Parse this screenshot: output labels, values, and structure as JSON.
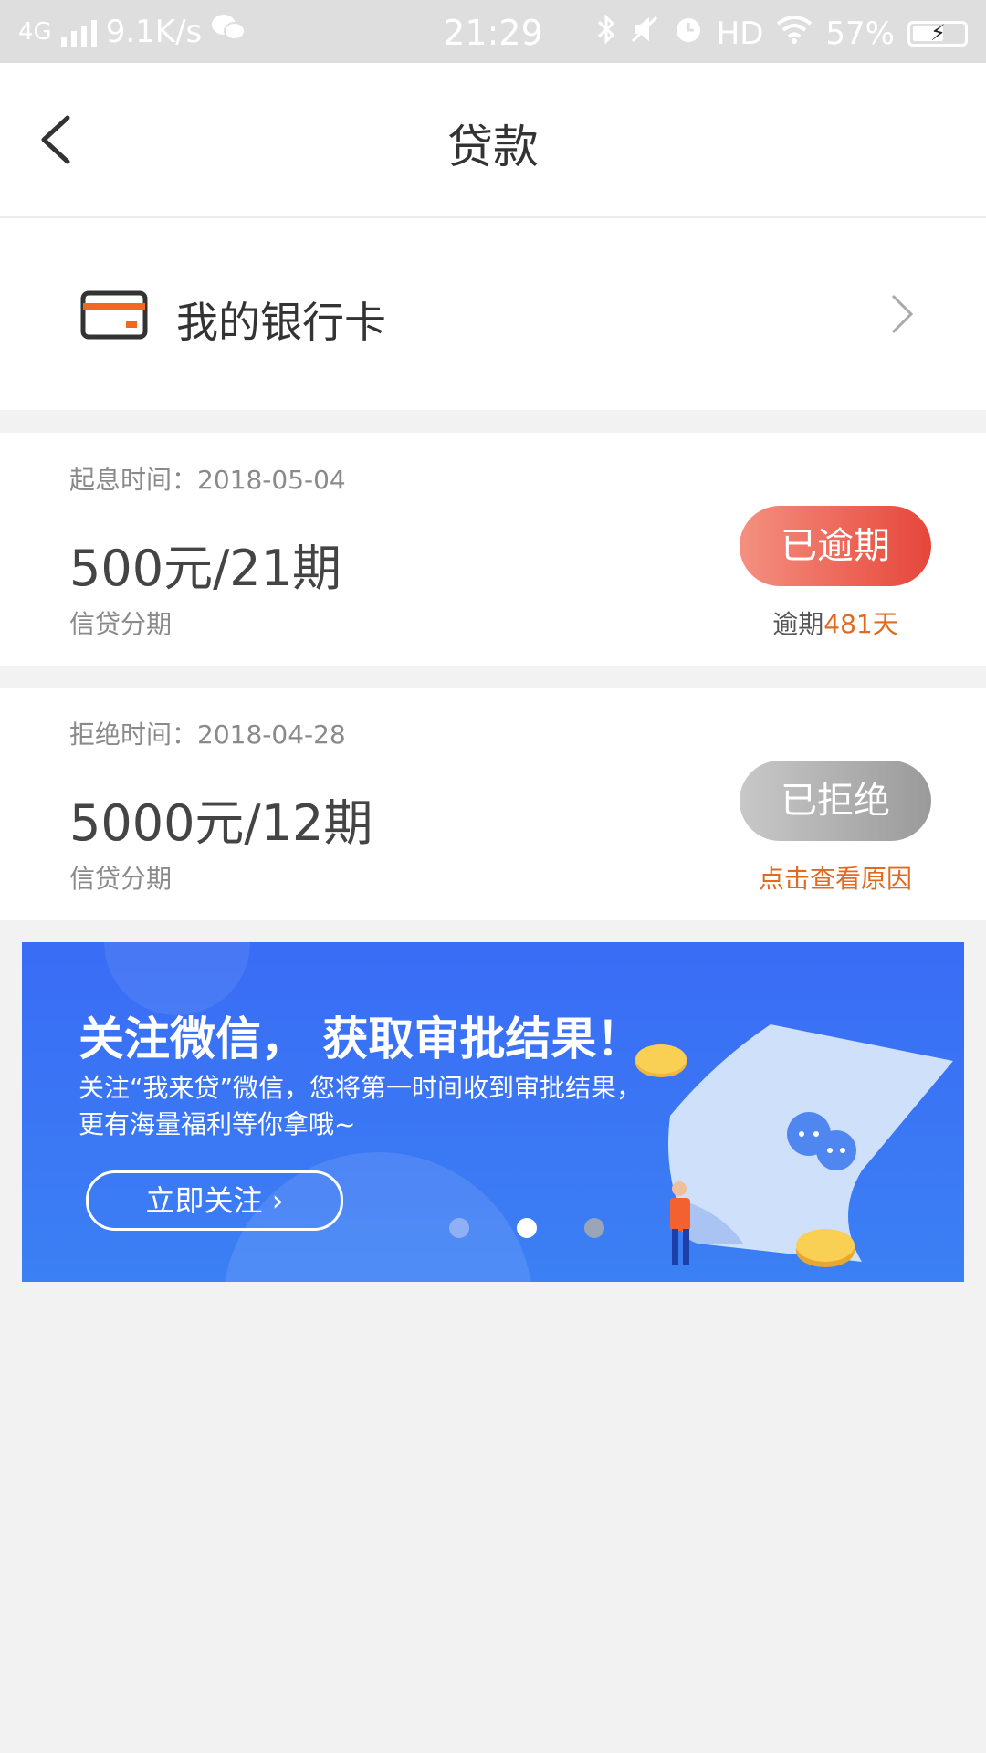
{
  "status_bar": {
    "network": "4G",
    "speed": "9.1K/s",
    "time": "21:29",
    "hd": "HD",
    "battery": "57%"
  },
  "header": {
    "title": "贷款"
  },
  "bank_card": {
    "label": "我的银行卡"
  },
  "loans": [
    {
      "date_label": "起息时间：",
      "date": "2018-05-04",
      "amount": "500元/21期",
      "kind": "信贷分期",
      "status": "已逾期",
      "sub_prefix": "逾期",
      "sub_highlight": "481天",
      "status_color": "#e6463a"
    },
    {
      "date_label": "拒绝时间：",
      "date": "2018-04-28",
      "amount": "5000元/12期",
      "kind": "信贷分期",
      "status": "已拒绝",
      "sub_link": "点击查看原因",
      "status_color": "#9a9a9a"
    }
  ],
  "banner": {
    "title": "关注微信， 获取审批结果！",
    "subtitle_line1": "关注“我来贷”微信，您将第一时间收到审批结果，",
    "subtitle_line2": "更有海量福利等你拿哦~",
    "button": "立即关注",
    "slides_total": 3,
    "slide_active": 2
  },
  "colors": {
    "accent_orange": "#e06a1f",
    "banner_blue": "#3a6cf5"
  }
}
